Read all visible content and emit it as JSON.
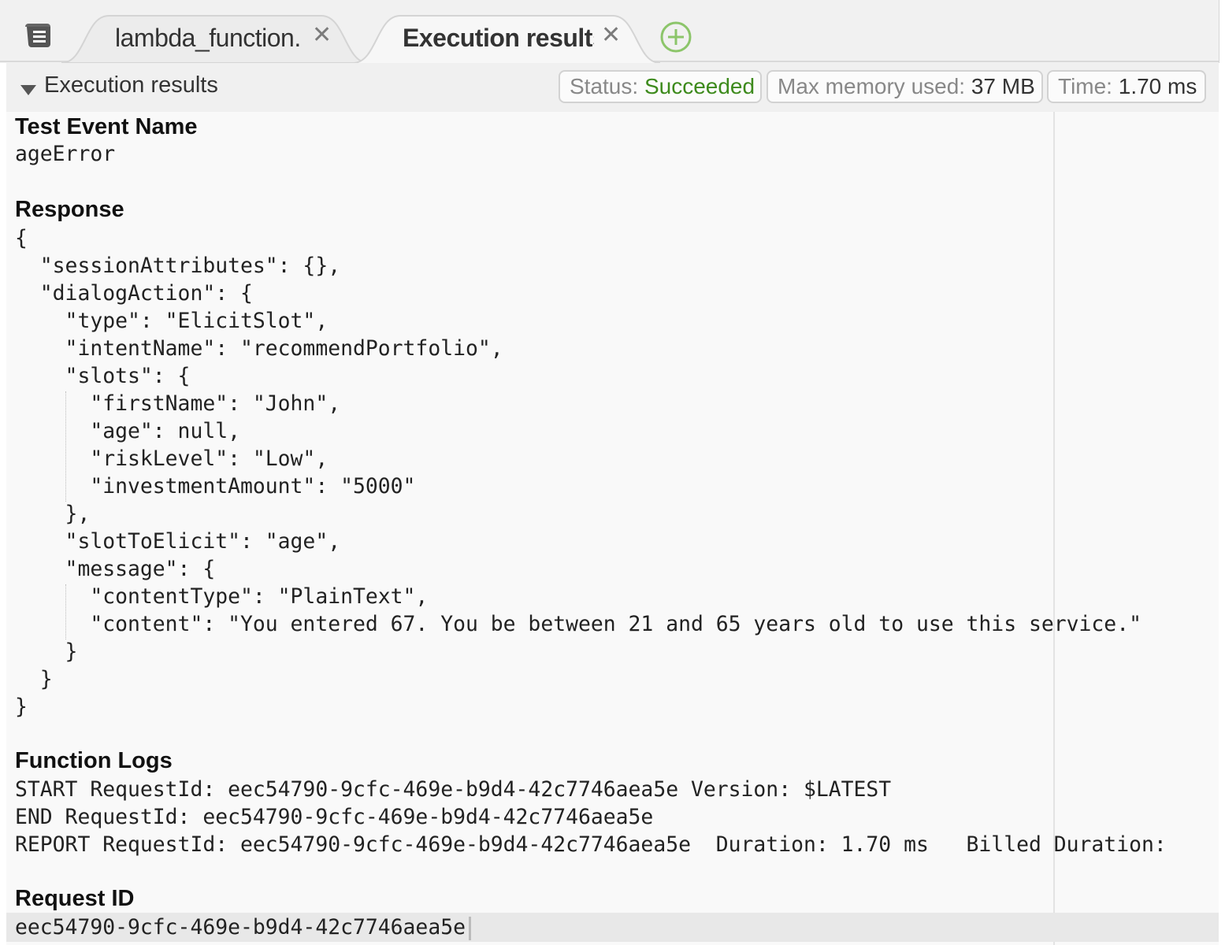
{
  "tabs": [
    {
      "label": "lambda_function.",
      "active": false
    },
    {
      "label": "Execution results",
      "active": true
    }
  ],
  "panel": {
    "title": "Execution results",
    "status_key": "Status:",
    "status_value": "Succeeded",
    "memory_key": "Max memory used:",
    "memory_value": "37 MB",
    "time_key": "Time:",
    "time_value": "1.70 ms"
  },
  "sections": {
    "test_event_name": {
      "heading": "Test Event Name",
      "value": "ageError"
    },
    "response": {
      "heading": "Response",
      "lines": [
        "{",
        "  \"sessionAttributes\": {},",
        "  \"dialogAction\": {",
        "    \"type\": \"ElicitSlot\",",
        "    \"intentName\": \"recommendPortfolio\",",
        "    \"slots\": {",
        "      \"firstName\": \"John\",",
        "      \"age\": null,",
        "      \"riskLevel\": \"Low\",",
        "      \"investmentAmount\": \"5000\"",
        "    },",
        "    \"slotToElicit\": \"age\",",
        "    \"message\": {",
        "      \"contentType\": \"PlainText\",",
        "      \"content\": \"You entered 67. You be between 21 and 65 years old to use this service.\"",
        "    }",
        "  }",
        "}"
      ]
    },
    "function_logs": {
      "heading": "Function Logs",
      "lines": [
        "START RequestId: eec54790-9cfc-469e-b9d4-42c7746aea5e Version: $LATEST",
        "END RequestId: eec54790-9cfc-469e-b9d4-42c7746aea5e",
        "REPORT RequestId: eec54790-9cfc-469e-b9d4-42c7746aea5e  Duration: 1.70 ms   Billed Duration:"
      ]
    },
    "request_id": {
      "heading": "Request ID",
      "value": "eec54790-9cfc-469e-b9d4-42c7746aea5e"
    }
  },
  "colors": {
    "success": "#3d8a1c",
    "add_tab": "#8cc56a"
  }
}
